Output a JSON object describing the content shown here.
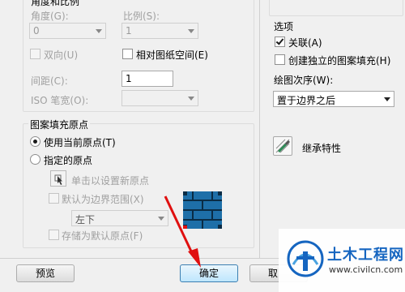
{
  "dialog": {
    "group_top_label": "角度和比例",
    "angle": {
      "label": "角度(G):",
      "value": "0"
    },
    "scale": {
      "label": "比例(S):",
      "value": "1"
    },
    "bidirectional": {
      "label": "双向(U)",
      "checked": false
    },
    "relative_paper": {
      "label": "相对图纸空间(E)",
      "checked": false
    },
    "spacing": {
      "label": "间距(C):",
      "value": "1"
    },
    "iso_pen": {
      "label": "ISO 笔宽(O):",
      "value": ""
    },
    "origin_group": {
      "title": "图案填充原点",
      "use_current": {
        "label": "使用当前原点(T)",
        "selected": true
      },
      "specified": {
        "label": "指定的原点",
        "selected": false
      },
      "click_to_set": "单击以设置新原点",
      "default_boundary": {
        "label": "默认为边界范围(X)",
        "checked": false
      },
      "position_select": "左下",
      "store_default": {
        "label": "存储为默认原点(F)",
        "checked": false
      }
    },
    "options": {
      "title": "选项",
      "associative": {
        "label": "关联(A)",
        "checked": true
      },
      "separate_hatches": {
        "label": "创建独立的图案填充(H)",
        "checked": false
      },
      "draw_order_label": "绘图次序(W):",
      "draw_order_value": "置于边界之后"
    },
    "inherit_properties": "继承特性",
    "buttons": {
      "preview": "预览",
      "ok": "确定",
      "cancel_partial": "取"
    }
  },
  "watermark": {
    "brand": "土木工程网",
    "url": "www.civilcn.com"
  },
  "colors": {
    "annotation_arrow": "#e01010",
    "brand_blue": "#1565c0",
    "hatch_blue": "#1e6fa8"
  }
}
